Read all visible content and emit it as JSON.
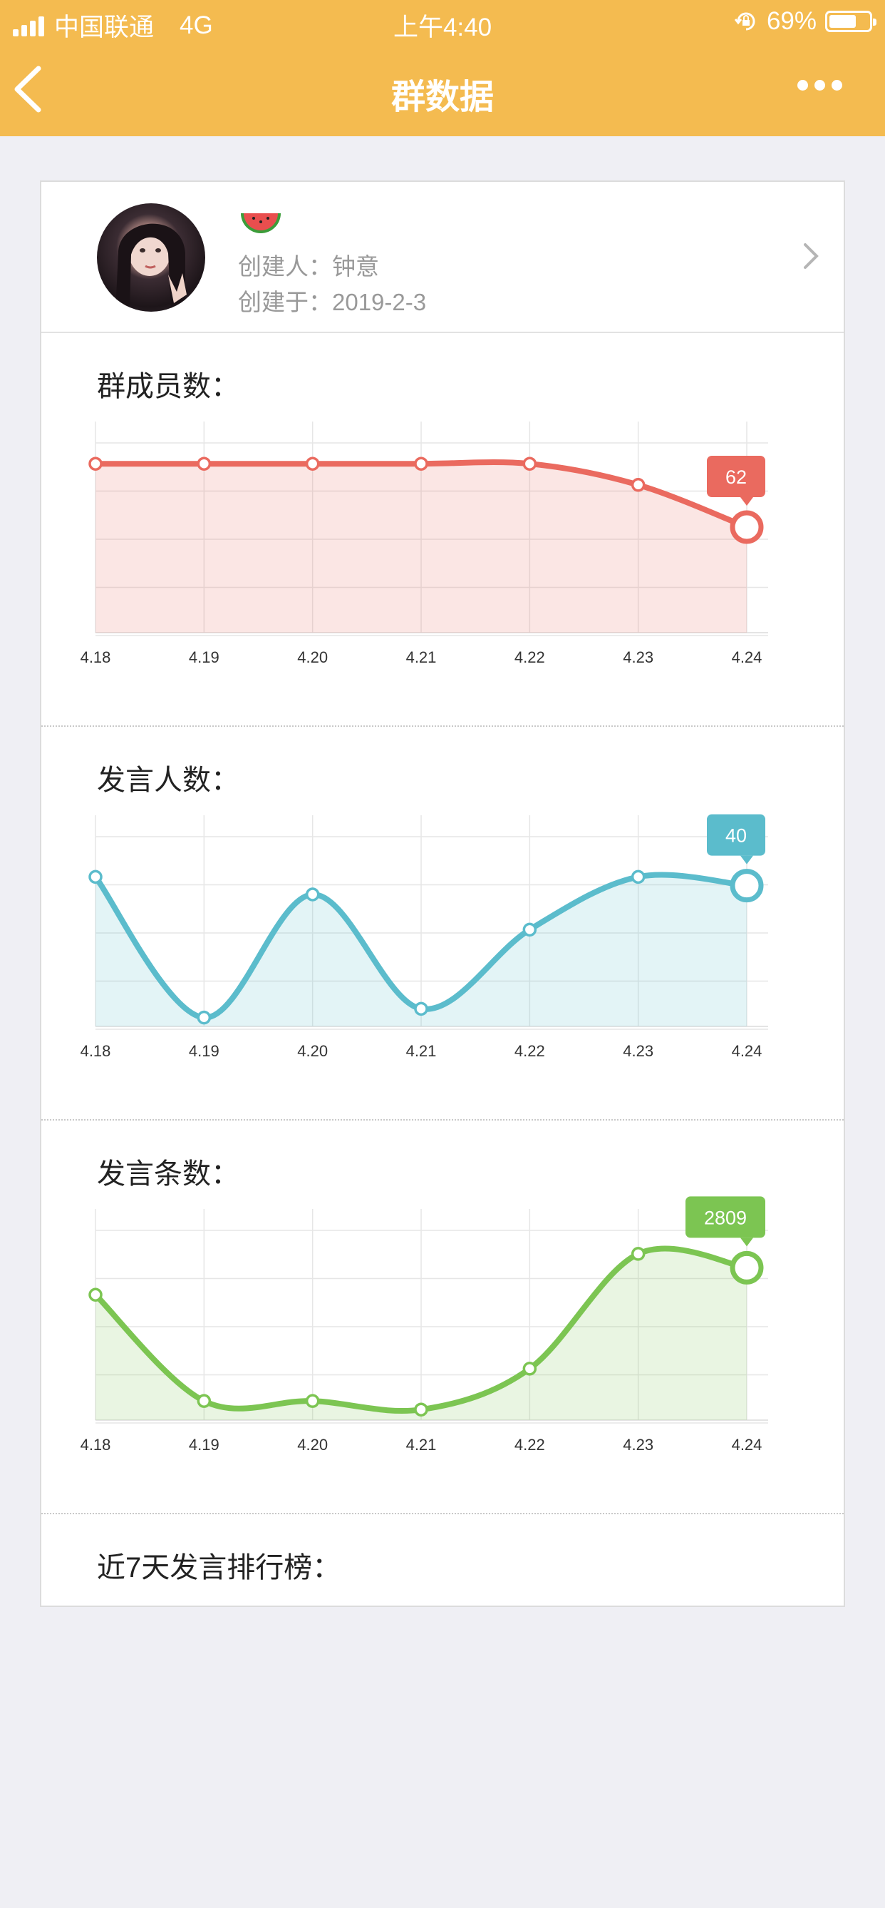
{
  "status_bar": {
    "carrier": "中国联通",
    "network": "4G",
    "time": "上午4:40",
    "battery": "69%",
    "battery_level": 0.69
  },
  "navbar": {
    "title": "群数据"
  },
  "group": {
    "creator": "创建人：钟意",
    "created": "创建于：2019-2-3"
  },
  "x_labels": [
    "4.18",
    "4.19",
    "4.20",
    "4.21",
    "4.22",
    "4.23",
    "4.24"
  ],
  "sections": {
    "members": {
      "title": "群成员数：",
      "badge": "62"
    },
    "speakers": {
      "title": "发言人数：",
      "badge": "40"
    },
    "messages": {
      "title": "发言条数：",
      "badge": "2809"
    },
    "ranking": {
      "title": "近7天发言排行榜："
    }
  },
  "colors": {
    "accent": "#f4bb50",
    "members": "#ea6a5f",
    "speakers": "#5bbccc",
    "messages": "#7cc552"
  },
  "chart_data": [
    {
      "type": "line",
      "categories": [
        "4.18",
        "4.19",
        "4.20",
        "4.21",
        "4.22",
        "4.23",
        "4.24"
      ],
      "values": [
        65,
        65,
        65,
        65,
        65,
        64,
        62
      ],
      "ylim": [
        57,
        67
      ],
      "color": "#ea6a5f",
      "highlight": "62"
    },
    {
      "type": "line",
      "categories": [
        "4.18",
        "4.19",
        "4.20",
        "4.21",
        "4.22",
        "4.23",
        "4.24"
      ],
      "values": [
        41,
        25,
        39,
        26,
        35,
        41,
        40
      ],
      "ylim": [
        24,
        48
      ],
      "color": "#5bbccc",
      "highlight": "40"
    },
    {
      "type": "line",
      "categories": [
        "4.18",
        "4.19",
        "4.20",
        "4.21",
        "4.22",
        "4.23",
        "4.24"
      ],
      "values": [
        2400,
        790,
        790,
        660,
        1280,
        3020,
        2809
      ],
      "ylim": [
        500,
        3700
      ],
      "color": "#7cc552",
      "highlight": "2809"
    }
  ]
}
